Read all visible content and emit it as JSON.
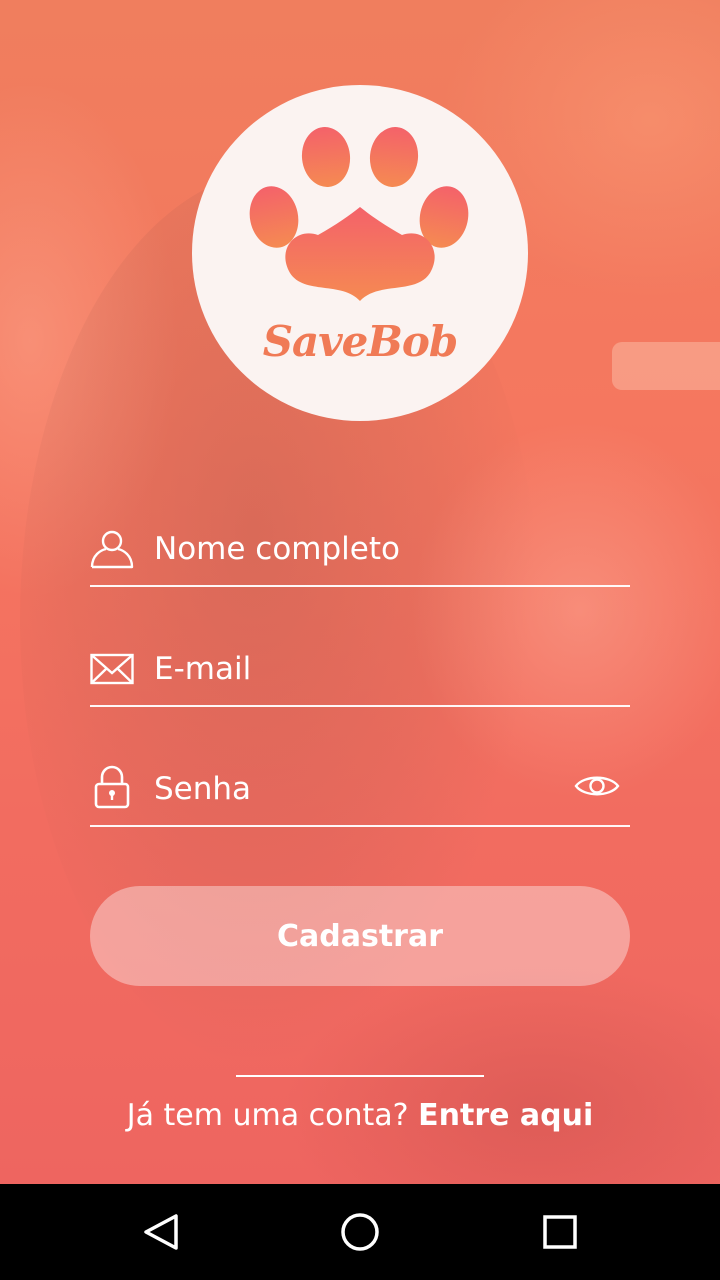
{
  "app": {
    "brand_name": "SaveBob",
    "accent_color": "#f26c60",
    "logo_icon": "paw-heart-icon"
  },
  "form": {
    "name": {
      "placeholder": "Nome completo",
      "value": "",
      "icon": "user-icon"
    },
    "email": {
      "placeholder": "E-mail",
      "value": "",
      "icon": "envelope-icon"
    },
    "password": {
      "placeholder": "Senha",
      "value": "",
      "icon": "lock-icon",
      "toggle_icon": "eye-icon"
    },
    "submit_label": "Cadastrar"
  },
  "footer": {
    "prompt": "Já tem uma conta?",
    "link": "Entre aqui"
  },
  "navbar": {
    "back_icon": "back-triangle-icon",
    "home_icon": "home-circle-icon",
    "recents_icon": "recents-square-icon"
  }
}
